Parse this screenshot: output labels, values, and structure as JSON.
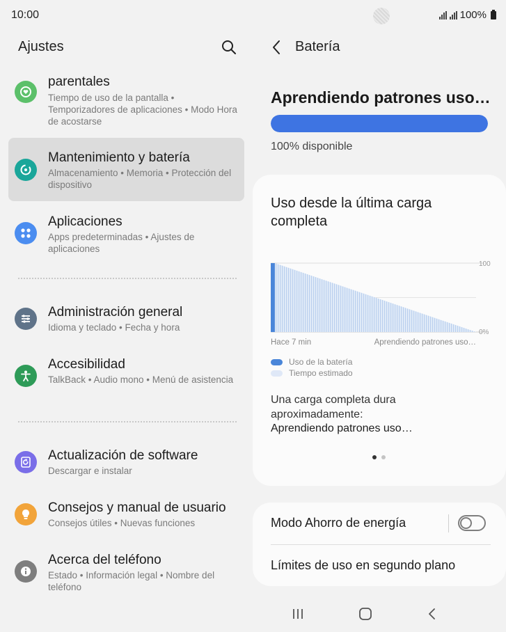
{
  "status": {
    "time": "10:00",
    "battery_percent": "100%"
  },
  "left": {
    "title": "Ajustes",
    "partial_item": {
      "title_line": "parentales",
      "sub": "Tiempo de uso de la pantalla • Temporizadores de aplicaciones • Modo Hora de acostarse",
      "icon": "parental-icon",
      "color": "#5cc06a"
    },
    "items": [
      {
        "title": "Mantenimiento y batería",
        "sub": "Almacenamiento • Memoria • Protección del dispositivo",
        "icon": "device-care-icon",
        "color": "#1aa69a",
        "selected": true
      },
      {
        "title": "Aplicaciones",
        "sub": "Apps predeterminadas • Ajustes de aplicaciones",
        "icon": "apps-icon",
        "color": "#4b8df0"
      },
      {
        "title": "Administración general",
        "sub": "Idioma y teclado • Fecha y hora",
        "icon": "sliders-icon",
        "color": "#5f7389"
      },
      {
        "title": "Accesibilidad",
        "sub": "TalkBack • Audio mono • Menú de asistencia",
        "icon": "accessibility-icon",
        "color": "#2e9b58"
      },
      {
        "title": "Actualización de software",
        "sub": "Descargar e instalar",
        "icon": "software-update-icon",
        "color": "#7a6ee8"
      },
      {
        "title": "Consejos y manual de usuario",
        "sub": "Consejos útiles • Nuevas funciones",
        "icon": "bulb-icon",
        "color": "#f2a43a"
      },
      {
        "title": "Acerca del teléfono",
        "sub": "Estado • Información legal • Nombre del teléfono",
        "icon": "info-icon",
        "color": "#7e7e7e"
      }
    ]
  },
  "right": {
    "title": "Batería",
    "learning": "Aprendiendo patrones uso…",
    "battery_level": 1.0,
    "available": "100% disponible",
    "usage_card": {
      "title": "Uso desde la última carga completa",
      "legend_usage": "Uso de la batería",
      "legend_estimated": "Tiempo estimado",
      "full_charge_label": "Una carga completa dura aproximadamente:",
      "full_charge_value": "Aprendiendo patrones uso…"
    },
    "power_saving": "Modo Ahorro de energía",
    "power_saving_on": false,
    "background_limits": "Límites de uso en segundo plano"
  },
  "chart_data": {
    "type": "area",
    "x_ticks": [
      "Hace 7 min",
      "Aprendiendo patrones uso…"
    ],
    "y_ticks": [
      "100",
      "0%"
    ],
    "ylim": [
      0,
      100
    ],
    "series": [
      {
        "name": "Uso de la batería",
        "x": [
          0,
          1
        ],
        "values": [
          100,
          100
        ],
        "color": "#4a86d9"
      },
      {
        "name": "Tiempo estimado",
        "x": [
          1,
          50
        ],
        "values": [
          100,
          0
        ],
        "color": "#bcd3ef"
      }
    ]
  },
  "colors": {
    "accent": "#3e74e2",
    "selected_bg": "#dcdcdc"
  }
}
